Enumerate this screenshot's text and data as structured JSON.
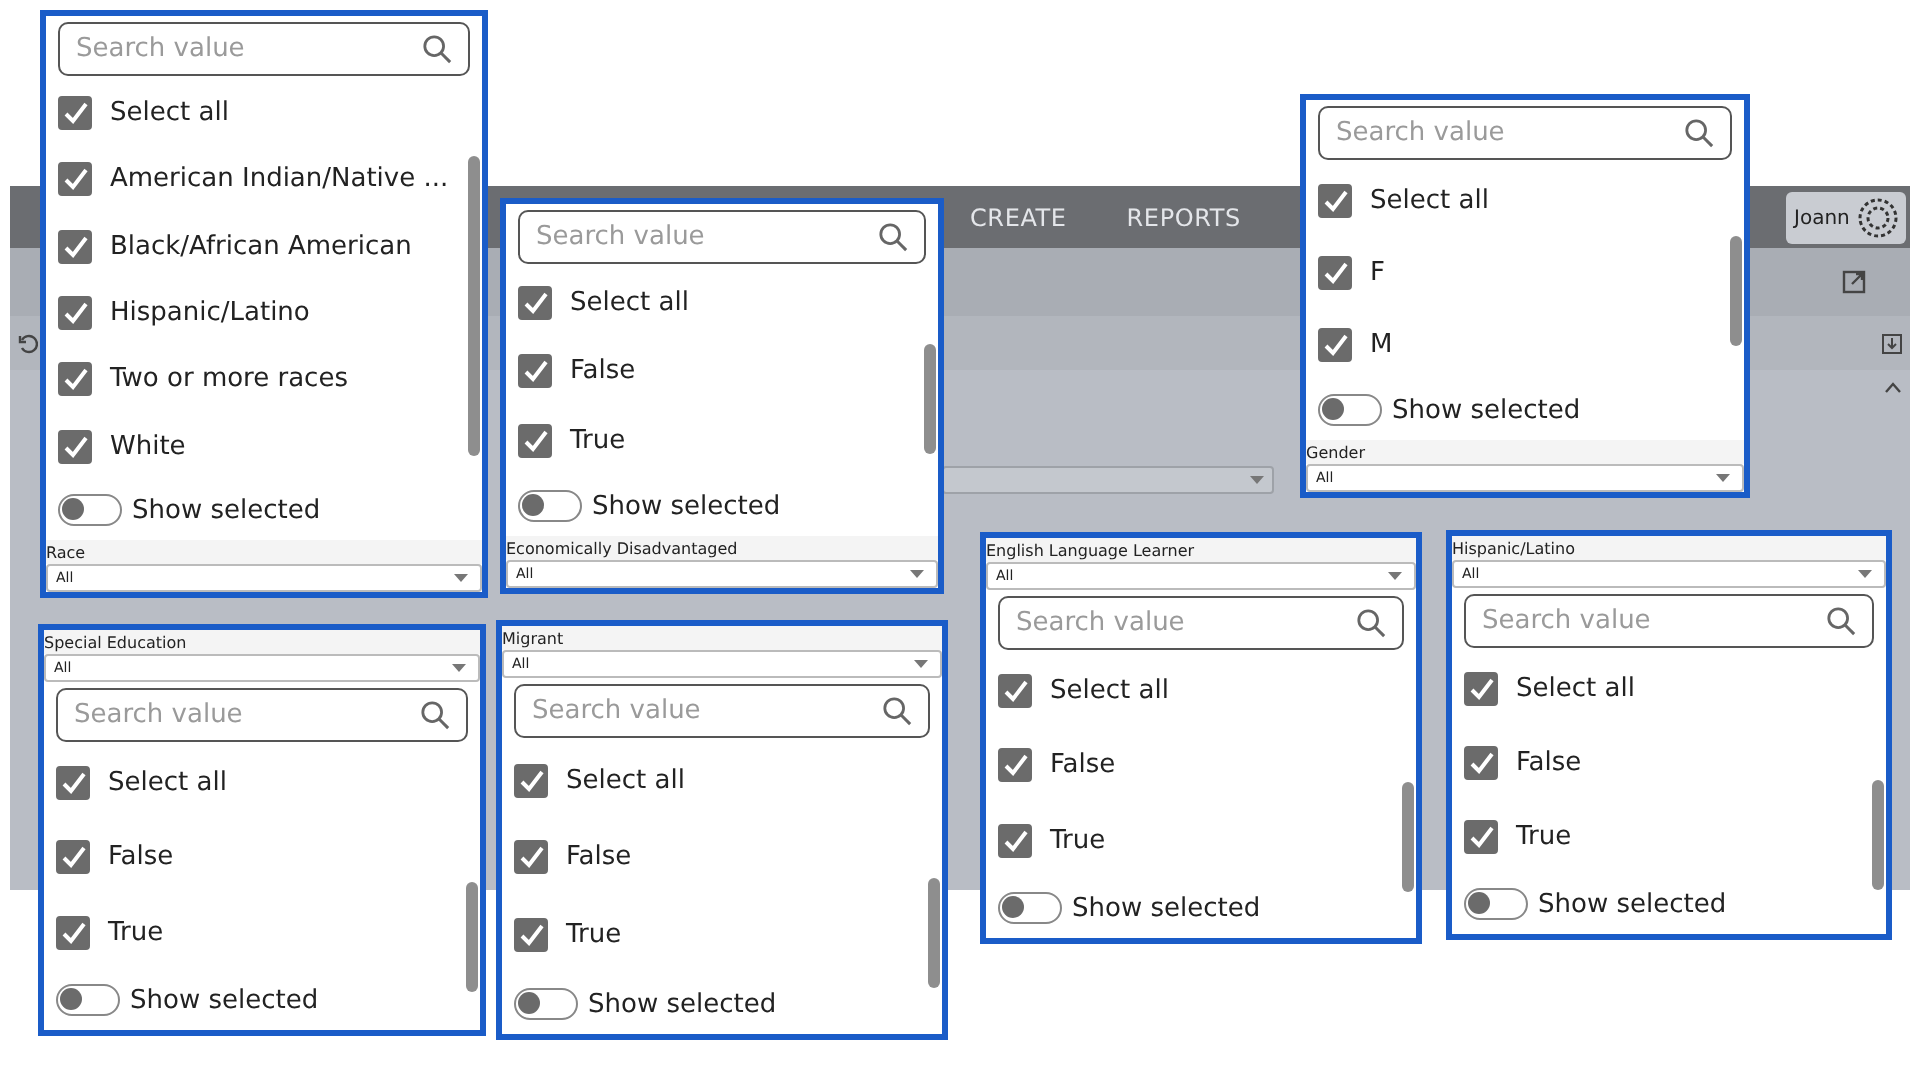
{
  "app": {
    "nav_items": [
      "CREATE",
      "REPORTS"
    ],
    "user": "Joann"
  },
  "panels": [
    {
      "label": "Race",
      "value": "All",
      "kind": "above",
      "search": {
        "placeholder": "Search value"
      },
      "items": [
        {
          "label": "Select all",
          "checked": true
        },
        {
          "label": "American Indian/Native ...",
          "checked": true
        },
        {
          "label": "Black/African American",
          "checked": true
        },
        {
          "label": "Hispanic/Latino",
          "checked": true
        },
        {
          "label": "Two or more races",
          "checked": true
        },
        {
          "label": "White",
          "checked": true
        }
      ],
      "toggle": {
        "label": "Show selected",
        "on": false
      }
    },
    {
      "label": "Economically Disadvantaged",
      "value": "All",
      "kind": "above",
      "search": {
        "placeholder": "Search value"
      },
      "items": [
        {
          "label": "Select all",
          "checked": true
        },
        {
          "label": "False",
          "checked": true
        },
        {
          "label": "True",
          "checked": true
        }
      ],
      "toggle": {
        "label": "Show selected",
        "on": false
      }
    },
    {
      "label": "Gender",
      "value": "All",
      "kind": "above",
      "search": {
        "placeholder": "Search value"
      },
      "items": [
        {
          "label": "Select all",
          "checked": true
        },
        {
          "label": "F",
          "checked": true
        },
        {
          "label": "M",
          "checked": true
        }
      ],
      "toggle": {
        "label": "Show selected",
        "on": false
      }
    },
    {
      "label": "English Language Learner",
      "value": "All",
      "kind": "below",
      "search": {
        "placeholder": "Search value"
      },
      "items": [
        {
          "label": "Select all",
          "checked": true
        },
        {
          "label": "False",
          "checked": true
        },
        {
          "label": "True",
          "checked": true
        }
      ],
      "toggle": {
        "label": "Show selected",
        "on": false
      }
    },
    {
      "label": "Hispanic/Latino",
      "value": "All",
      "kind": "below",
      "search": {
        "placeholder": "Search value"
      },
      "items": [
        {
          "label": "Select all",
          "checked": true
        },
        {
          "label": "False",
          "checked": true
        },
        {
          "label": "True",
          "checked": true
        }
      ],
      "toggle": {
        "label": "Show selected",
        "on": false
      }
    },
    {
      "label": "Special Education",
      "value": "All",
      "kind": "below",
      "search": {
        "placeholder": "Search value"
      },
      "items": [
        {
          "label": "Select all",
          "checked": true
        },
        {
          "label": "False",
          "checked": true
        },
        {
          "label": "True",
          "checked": true
        }
      ],
      "toggle": {
        "label": "Show selected",
        "on": false
      }
    },
    {
      "label": "Migrant",
      "value": "All",
      "kind": "below",
      "search": {
        "placeholder": "Search value"
      },
      "items": [
        {
          "label": "Select all",
          "checked": true
        },
        {
          "label": "False",
          "checked": true
        },
        {
          "label": "True",
          "checked": true
        }
      ],
      "toggle": {
        "label": "Show selected",
        "on": false
      }
    }
  ]
}
